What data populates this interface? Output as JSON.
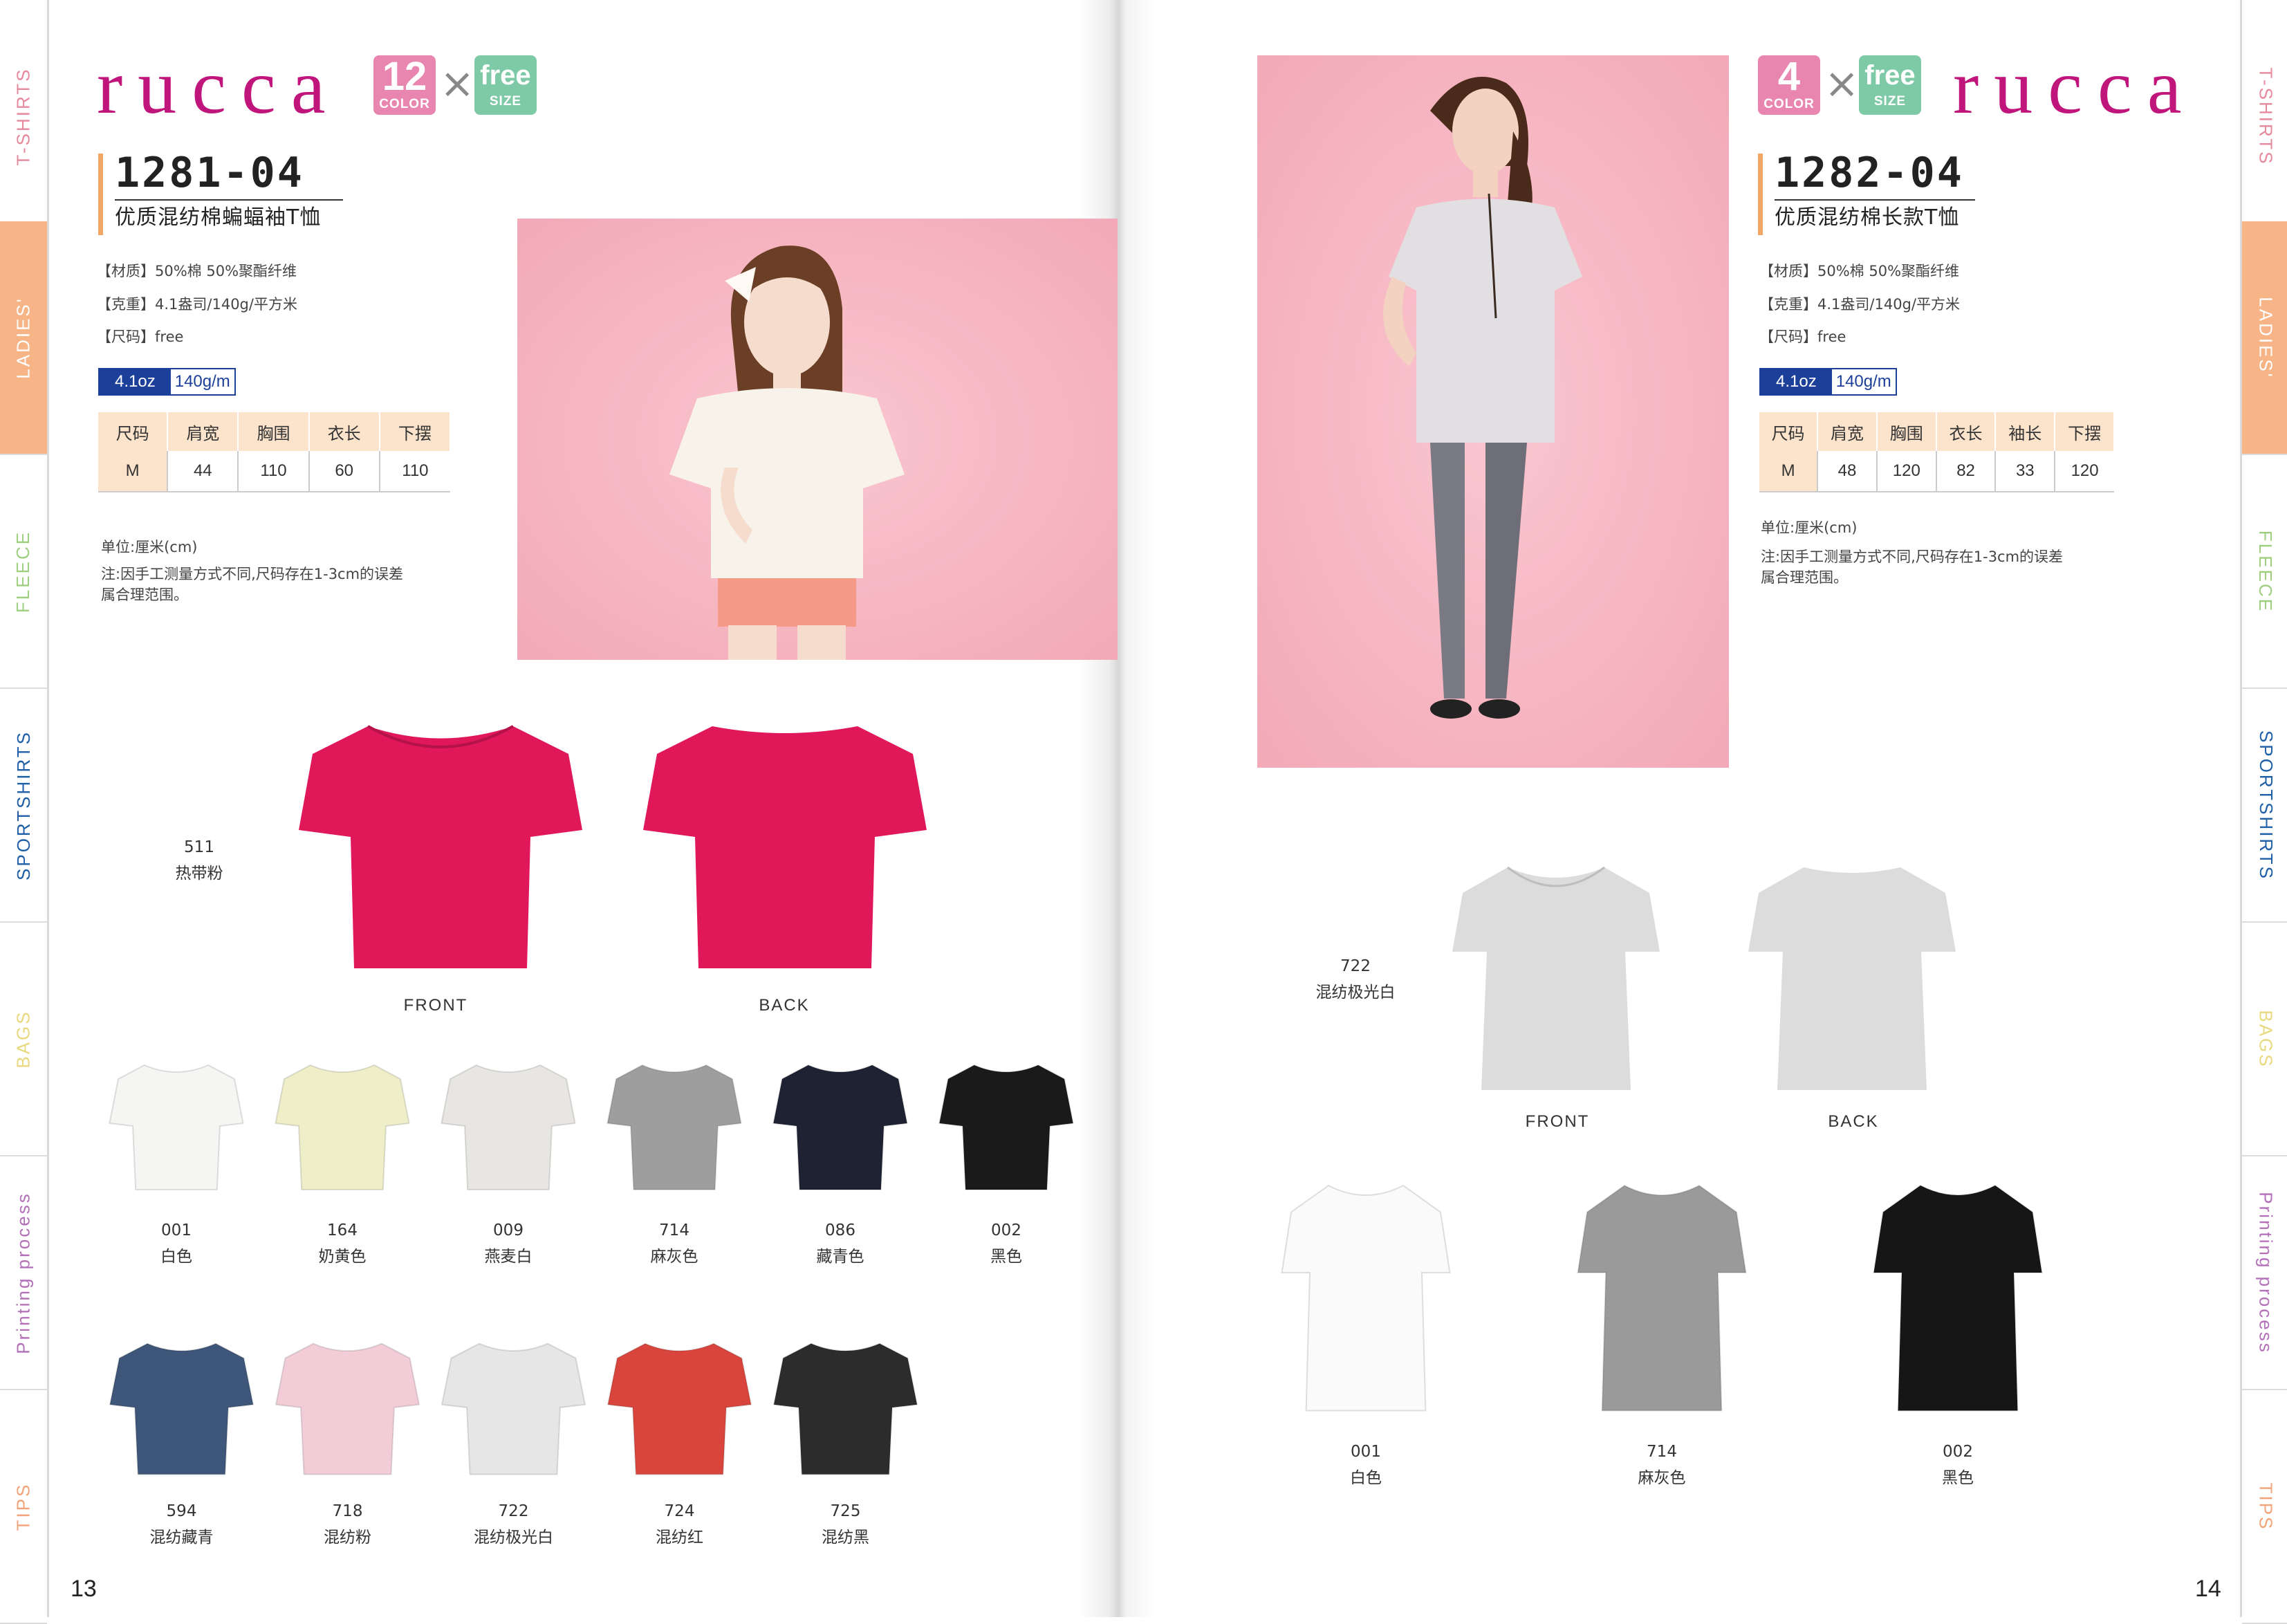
{
  "sidebar": {
    "tabs": [
      {
        "label": "T-SHIRTS",
        "color": "#e7899c"
      },
      {
        "label": "LADIES'",
        "color": "#ffffff"
      },
      {
        "label": "FLEECE",
        "color": "#9dcf7f"
      },
      {
        "label": "SPORTSHIRTS",
        "color": "#1f5fa8"
      },
      {
        "label": "BAGS",
        "color": "#f0e08a"
      },
      {
        "label": "Printing process",
        "color": "#b36fb8"
      },
      {
        "label": "TIPS",
        "color": "#f3a37a"
      }
    ],
    "active_tab": "LADIES'"
  },
  "left_page": {
    "brand": "rucca",
    "badge_color": {
      "number": "12",
      "label": "COLOR"
    },
    "times": "×",
    "badge_size": {
      "word": "free",
      "label": "SIZE"
    },
    "code": "1281-04",
    "title": "优质混纺棉蝙蝠袖T恤",
    "specs": [
      "【材质】50%棉  50%聚酯纤维",
      "【克重】4.1盎司/140g/平方米",
      "【尺码】free"
    ],
    "weight": {
      "oz": "4.1oz",
      "gsm": "140g/m"
    },
    "size_table": {
      "headers": [
        "尺码",
        "肩宽",
        "胸围",
        "衣长",
        "下摆"
      ],
      "rows": [
        [
          "M",
          "44",
          "110",
          "60",
          "110"
        ]
      ]
    },
    "notes": [
      "单位:厘米(cm)",
      "注:因手工测量方式不同,尺码存在1-3cm的误差",
      "属合理范围。"
    ],
    "featured": {
      "code": "511",
      "name": "热带粉",
      "color": "#e0185a"
    },
    "front_label": "FRONT",
    "back_label": "BACK",
    "colors_row1": [
      {
        "code": "001",
        "name": "白色",
        "color": "#f5f5f3"
      },
      {
        "code": "164",
        "name": "奶黄色",
        "color": "#eeeec8"
      },
      {
        "code": "009",
        "name": "燕麦白",
        "color": "#e8e6e2"
      },
      {
        "code": "714",
        "name": "麻灰色",
        "color": "#9e9e9e"
      },
      {
        "code": "086",
        "name": "藏青色",
        "color": "#1e2233"
      },
      {
        "code": "002",
        "name": "黑色",
        "color": "#1a1a1a"
      }
    ],
    "colors_row2": [
      {
        "code": "594",
        "name": "混纺藏青",
        "color": "#3e5679"
      },
      {
        "code": "718",
        "name": "混纺粉",
        "color": "#f2cdd8"
      },
      {
        "code": "722",
        "name": "混纺极光白",
        "color": "#e6e6e6"
      },
      {
        "code": "724",
        "name": "混纺红",
        "color": "#d9453c"
      },
      {
        "code": "725",
        "name": "混纺黑",
        "color": "#2c2c2c"
      }
    ],
    "page_number": "13"
  },
  "right_page": {
    "brand": "rucca",
    "badge_color": {
      "number": "4",
      "label": "COLOR"
    },
    "times": "×",
    "badge_size": {
      "word": "free",
      "label": "SIZE"
    },
    "code": "1282-04",
    "title": "优质混纺棉长款T恤",
    "specs": [
      "【材质】50%棉  50%聚酯纤维",
      "【克重】4.1盎司/140g/平方米",
      "【尺码】free"
    ],
    "weight": {
      "oz": "4.1oz",
      "gsm": "140g/m"
    },
    "size_table": {
      "headers": [
        "尺码",
        "肩宽",
        "胸围",
        "衣长",
        "袖长",
        "下摆"
      ],
      "rows": [
        [
          "M",
          "48",
          "120",
          "82",
          "33",
          "120"
        ]
      ]
    },
    "notes": [
      "单位:厘米(cm)",
      "注:因手工测量方式不同,尺码存在1-3cm的误差",
      "属合理范围。"
    ],
    "featured": {
      "code": "722",
      "name": "混纺极光白",
      "color": "#dcdcdc"
    },
    "front_label": "FRONT",
    "back_label": "BACK",
    "colors": [
      {
        "code": "001",
        "name": "白色",
        "color": "#fafafa"
      },
      {
        "code": "714",
        "name": "麻灰色",
        "color": "#9a9a9a"
      },
      {
        "code": "002",
        "name": "黑色",
        "color": "#161616"
      }
    ],
    "page_number": "14"
  }
}
